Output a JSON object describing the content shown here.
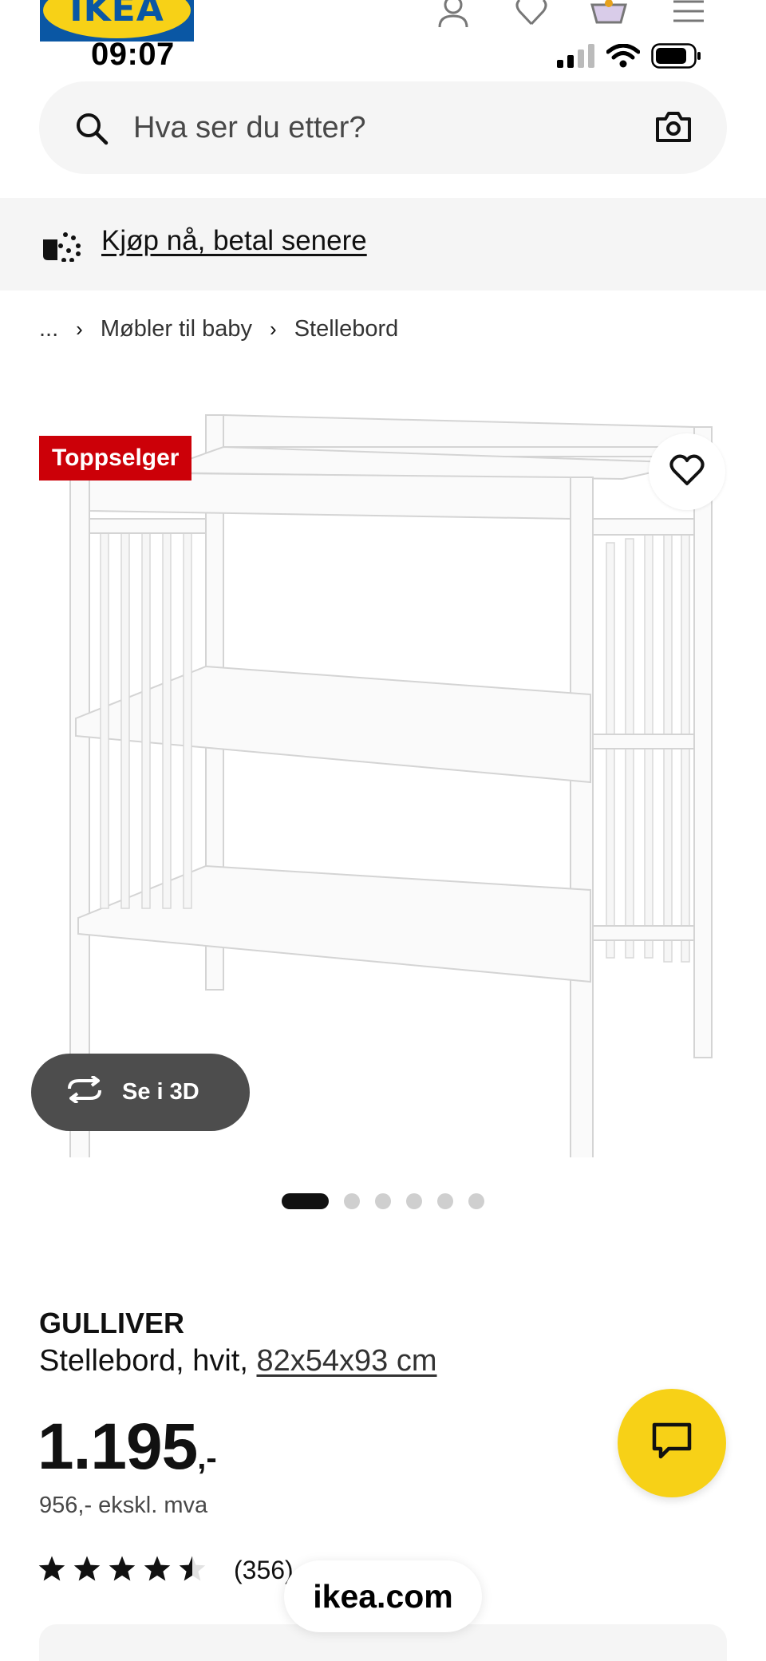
{
  "header": {
    "logo_text": "IKEA",
    "icons": [
      "user-icon",
      "heart-icon",
      "basket-icon",
      "menu-icon"
    ]
  },
  "status_bar": {
    "time": "09:07",
    "icons": [
      "signal-icon",
      "wifi-icon",
      "battery-icon"
    ]
  },
  "search": {
    "placeholder": "Hva ser du etter?",
    "value": ""
  },
  "promo": {
    "label": "Kjøp nå, betal senere"
  },
  "breadcrumb": {
    "items": [
      "...",
      "Møbler til baby",
      "Stellebord"
    ]
  },
  "product": {
    "badge": "Toppselger",
    "view_3d_label": "Se i 3D",
    "image_count": 6,
    "active_image": 1,
    "name": "GULLIVER",
    "description": "Stellebord, hvit, ",
    "dimensions": "82x54x93 cm",
    "price": "1.195",
    "price_suffix": ",-",
    "price_ex_vat": "956,- ekskl. mva",
    "rating": 4.5,
    "rating_max": 5,
    "review_count": "(356)"
  },
  "browser": {
    "url": "ikea.com"
  },
  "colors": {
    "badge_red": "#cc0008",
    "chat_yellow": "#f7d117",
    "ikea_blue": "#0a57a4",
    "btn_3d_gray": "#4d4d4d"
  }
}
